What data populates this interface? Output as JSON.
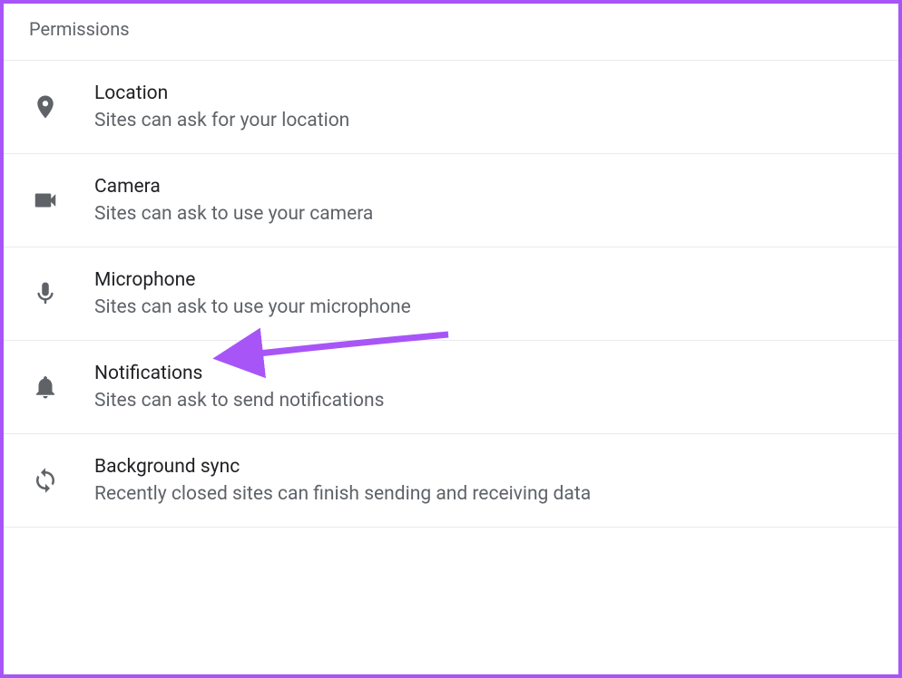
{
  "section": {
    "title": "Permissions"
  },
  "items": [
    {
      "title": "Location",
      "desc": "Sites can ask for your location"
    },
    {
      "title": "Camera",
      "desc": "Sites can ask to use your camera"
    },
    {
      "title": "Microphone",
      "desc": "Sites can ask to use your microphone"
    },
    {
      "title": "Notifications",
      "desc": "Sites can ask to send notifications"
    },
    {
      "title": "Background sync",
      "desc": "Recently closed sites can finish sending and receiving data"
    }
  ]
}
